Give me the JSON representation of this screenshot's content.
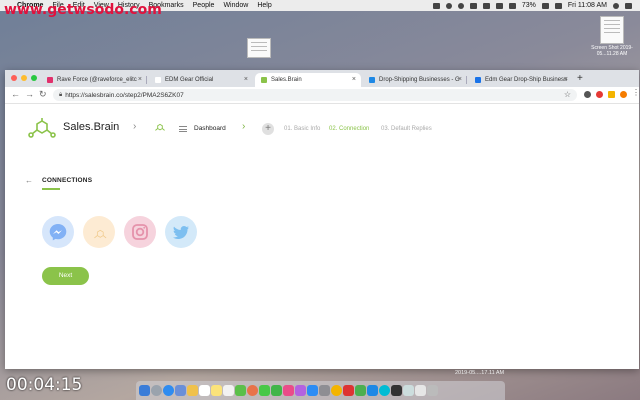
{
  "watermark": "www.getwsodo.com",
  "menubar": {
    "apple": "",
    "app": "Chrome",
    "items": [
      "File",
      "Edit",
      "View",
      "History",
      "Bookmarks",
      "People",
      "Window",
      "Help"
    ],
    "battery": "73%",
    "clock": "Fri 11:08 AM"
  },
  "desktop": {
    "file_label": "Screen Shot\n2019-05...11.28 AM"
  },
  "tabs": [
    {
      "title": "Rave Force (@raveforce_elitc",
      "color": "#e1306c"
    },
    {
      "title": "EDM Gear Official",
      "color": "#ffffff"
    },
    {
      "title": "Sales.Brain",
      "color": "#8bc34a"
    },
    {
      "title": "Drop-Shipping Businesses - G",
      "color": "#1e88e5"
    },
    {
      "title": "Edm Gear Drop-Ship Business",
      "color": "#1a73e8"
    }
  ],
  "toolbar": {
    "url": "https://salesbrain.co/step2/PMA2S6ZK07"
  },
  "page": {
    "brand": "Sales.Brain",
    "dashboard": "Dashboard",
    "steps": [
      {
        "label": "01. Basic Info",
        "active": false
      },
      {
        "label": "02. Connection",
        "active": true
      },
      {
        "label": "03. Default Replies",
        "active": false
      }
    ],
    "section_title": "CONNECTIONS",
    "socials": [
      "messenger-icon",
      "salesbrain-icon",
      "instagram-icon",
      "twitter-icon"
    ],
    "next_label": "Next"
  },
  "overlay": {
    "timer": "00:04:15",
    "dock_date": "2019-05....17.11 AM"
  },
  "colors": {
    "accent": "#8bc34a",
    "watermark": "#e0123d"
  }
}
